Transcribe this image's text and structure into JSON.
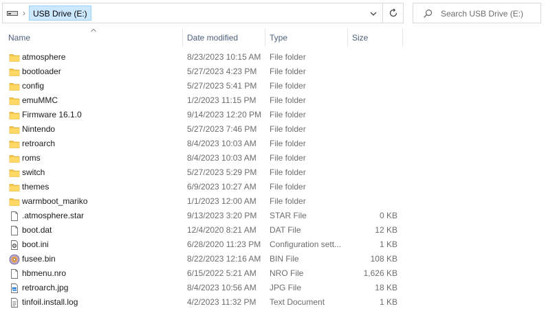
{
  "address": {
    "drive_label": "USB Drive (E:)"
  },
  "search": {
    "placeholder": "Search USB Drive (E:)"
  },
  "columns": {
    "name": "Name",
    "date": "Date modified",
    "type": "Type",
    "size": "Size"
  },
  "files": [
    {
      "name": "atmosphere",
      "date": "8/23/2023 10:15 AM",
      "type": "File folder",
      "size": "",
      "icon": "folder-icon"
    },
    {
      "name": "bootloader",
      "date": "5/27/2023 4:23 PM",
      "type": "File folder",
      "size": "",
      "icon": "folder-icon"
    },
    {
      "name": "config",
      "date": "5/27/2023 5:41 PM",
      "type": "File folder",
      "size": "",
      "icon": "folder-icon"
    },
    {
      "name": "emuMMC",
      "date": "1/2/2023 11:15 PM",
      "type": "File folder",
      "size": "",
      "icon": "folder-icon"
    },
    {
      "name": "Firmware 16.1.0",
      "date": "9/14/2023 12:20 PM",
      "type": "File folder",
      "size": "",
      "icon": "folder-icon"
    },
    {
      "name": "Nintendo",
      "date": "5/27/2023 7:46 PM",
      "type": "File folder",
      "size": "",
      "icon": "folder-icon"
    },
    {
      "name": "retroarch",
      "date": "8/4/2023 10:03 AM",
      "type": "File folder",
      "size": "",
      "icon": "folder-icon"
    },
    {
      "name": "roms",
      "date": "8/4/2023 10:03 AM",
      "type": "File folder",
      "size": "",
      "icon": "folder-icon"
    },
    {
      "name": "switch",
      "date": "5/27/2023 5:29 PM",
      "type": "File folder",
      "size": "",
      "icon": "folder-icon"
    },
    {
      "name": "themes",
      "date": "6/9/2023 10:27 AM",
      "type": "File folder",
      "size": "",
      "icon": "folder-icon"
    },
    {
      "name": "warmboot_mariko",
      "date": "1/1/2023 12:00 AM",
      "type": "File folder",
      "size": "",
      "icon": "folder-icon"
    },
    {
      "name": ".atmosphere.star",
      "date": "9/13/2023 3:20 PM",
      "type": "STAR File",
      "size": "0 KB",
      "icon": "file-icon"
    },
    {
      "name": "boot.dat",
      "date": "12/4/2020 8:21 AM",
      "type": "DAT File",
      "size": "12 KB",
      "icon": "file-icon"
    },
    {
      "name": "boot.ini",
      "date": "6/28/2020 11:23 PM",
      "type": "Configuration sett...",
      "size": "1 KB",
      "icon": "settings-file-icon"
    },
    {
      "name": "fusee.bin",
      "date": "8/22/2023 12:16 AM",
      "type": "BIN File",
      "size": "108 KB",
      "icon": "disc-image-icon"
    },
    {
      "name": "hbmenu.nro",
      "date": "6/15/2022 5:21 AM",
      "type": "NRO File",
      "size": "1,626 KB",
      "icon": "file-icon"
    },
    {
      "name": "retroarch.jpg",
      "date": "8/4/2023 10:56 AM",
      "type": "JPG File",
      "size": "18 KB",
      "icon": "image-file-icon"
    },
    {
      "name": "tinfoil.install.log",
      "date": "4/2/2023 11:32 PM",
      "type": "Text Document",
      "size": "1 KB",
      "icon": "text-file-icon"
    }
  ]
}
